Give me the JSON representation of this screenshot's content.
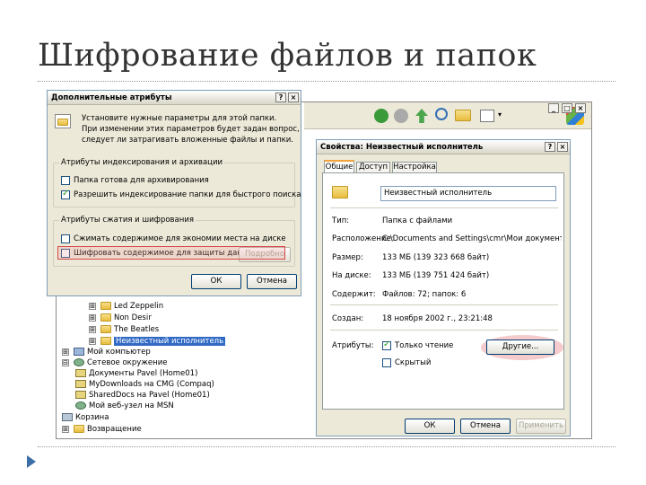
{
  "slide": {
    "title": "Шифрование файлов и папок"
  },
  "explorer": {
    "tree": [
      {
        "label": "Led Zeppelin",
        "expander": "⊞",
        "icon": "folder"
      },
      {
        "label": "Non Desir",
        "expander": "⊞",
        "icon": "folder"
      },
      {
        "label": "The Beatles",
        "expander": "⊞",
        "icon": "folder"
      },
      {
        "label": "Неизвестный исполнитель",
        "expander": "⊞",
        "icon": "folder",
        "selected": true
      },
      {
        "label": "Мой компьютер",
        "expander": "⊞",
        "icon": "my-computer"
      },
      {
        "label": "Сетевое окружение",
        "expander": "⊟",
        "icon": "network"
      },
      {
        "label": "Документы Pavel (Home01)",
        "expander": "",
        "icon": "shared-folder"
      },
      {
        "label": "MyDownloads на CMG (Compaq)",
        "expander": "",
        "icon": "shared-folder"
      },
      {
        "label": "SharedDocs на Pavel (Home01)",
        "expander": "",
        "icon": "shared-folder"
      },
      {
        "label": "Мой веб-узел на MSN",
        "expander": "",
        "icon": "msn"
      },
      {
        "label": "Корзина",
        "expander": "",
        "icon": "recycle-bin"
      },
      {
        "label": "Возвращение",
        "expander": "⊞",
        "icon": "folder"
      }
    ]
  },
  "properties": {
    "title": "Свойства: Неизвестный исполнитель",
    "tabs": [
      "Общие",
      "Доступ",
      "Настройка"
    ],
    "name_value": "Неизвестный исполнитель",
    "rows": [
      {
        "label": "Тип:",
        "value": "Папка с файлами"
      },
      {
        "label": "Расположение:",
        "value": "C:\\Documents and Settings\\cmr\\Мои документы\\Мо"
      },
      {
        "label": "Размер:",
        "value": "133 МБ (139 323 668 байт)"
      },
      {
        "label": "На диске:",
        "value": "133 МБ (139 751 424 байт)"
      },
      {
        "label": "Содержит:",
        "value": "Файлов: 72; папок: 6"
      },
      {
        "label": "Создан:",
        "value": "18 ноября 2002 г., 23:21:48"
      }
    ],
    "attributes_label": "Атрибуты:",
    "readonly_label": "Только чтение",
    "hidden_label": "Скрытый",
    "other_button": "Другие...",
    "ok": "ОК",
    "cancel": "Отмена",
    "apply": "Применить"
  },
  "advanced": {
    "title": "Дополнительные атрибуты",
    "help": "?",
    "close": "×",
    "intro_line1": "Установите нужные параметры для этой папки.",
    "intro_line2": "При изменении этих параметров будет задан вопрос,",
    "intro_line3": "следует ли затрагивать вложенные файлы и папки.",
    "group1_title": "Атрибуты индексирования и архивации",
    "archive_label": "Папка готова для архивирования",
    "index_label": "Разрешить индексирование папки для быстрого поиска",
    "group2_title": "Атрибуты сжатия и шифрования",
    "compress_label": "Сжимать содержимое для экономии места на диске",
    "encrypt_label": "Шифровать содержимое для защиты данных",
    "details_button": "Подробно",
    "ok": "ОК",
    "cancel": "Отмена"
  }
}
